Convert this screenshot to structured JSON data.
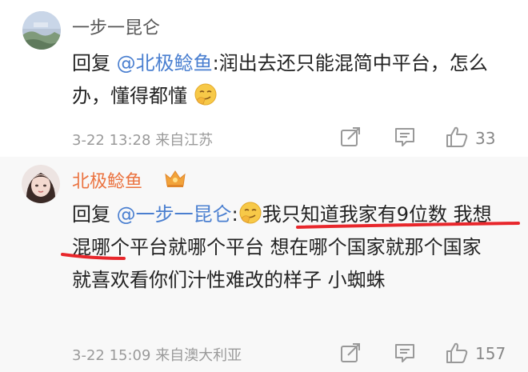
{
  "comments": [
    {
      "username": "一步一昆仑",
      "reply_prefix": "回复",
      "mention": "@北极鲶鱼",
      "text": ":润出去还只能混简中平台，怎么办，懂得都懂",
      "timestamp": "3-22 13:28",
      "location": "来自江苏",
      "like_count": "33"
    },
    {
      "username": "北极鲶鱼",
      "reply_prefix": "回复",
      "mention": "@一步一昆仑",
      "colon": ":",
      "text": "我只知道我家有9位数 我想混哪个平台就哪个平台 想在哪个国家就那个国家 就喜欢看你们汁性难改的样子 小蜘蛛",
      "timestamp": "3-22 15:09",
      "location": "来自澳大利亚",
      "like_count": "157"
    }
  ],
  "colors": {
    "mention": "#4a7fd0",
    "username_vip": "#eb7340",
    "underline": "#e8262b"
  },
  "icons": [
    "smirk-emoji-icon",
    "vip-crown-badge-icon",
    "share-icon",
    "comment-icon",
    "like-icon"
  ]
}
